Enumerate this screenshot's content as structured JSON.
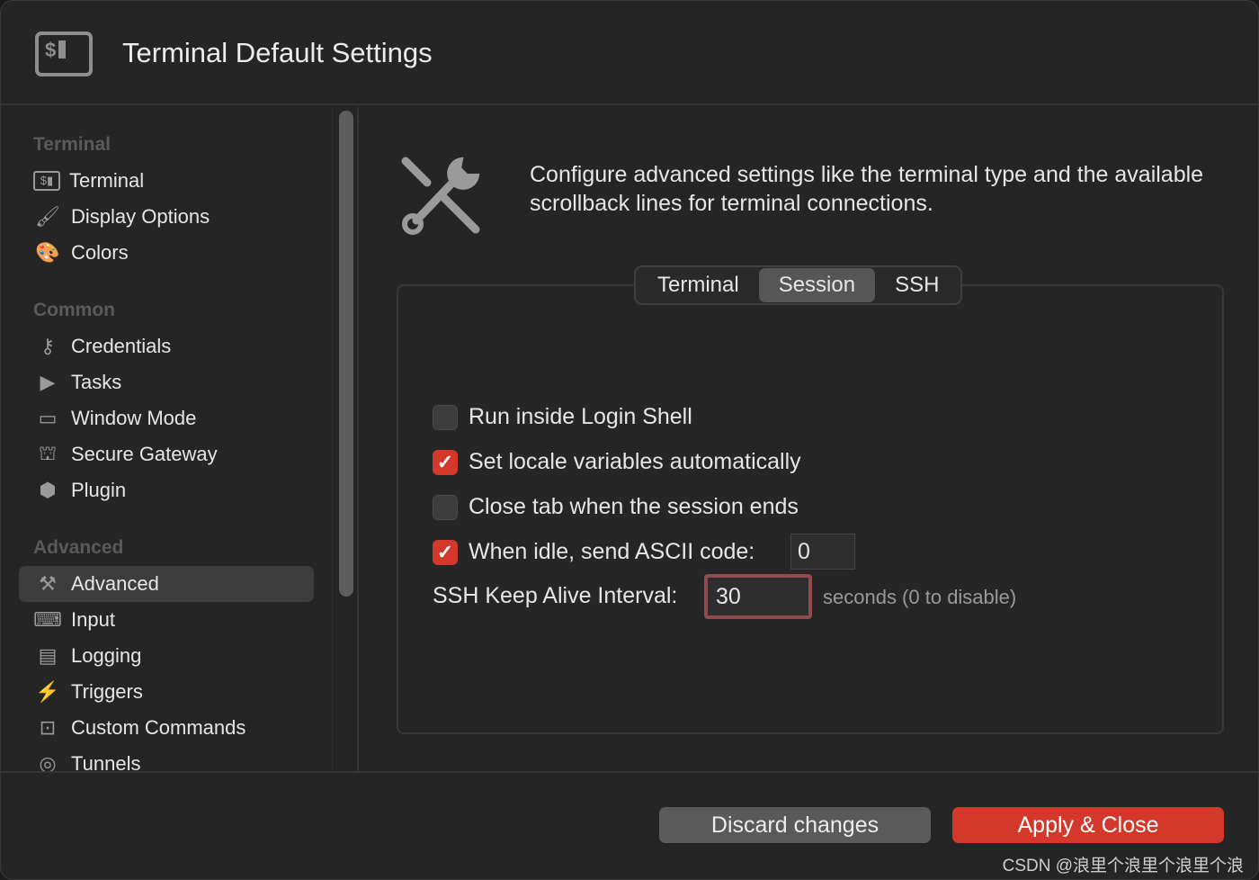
{
  "window": {
    "title": "Terminal Default Settings",
    "icon": "terminal-icon"
  },
  "sidebar": {
    "sections": [
      {
        "label": "Terminal",
        "items": [
          {
            "label": "Terminal",
            "icon": "terminal-icon"
          },
          {
            "label": "Display Options",
            "icon": "paintbrush-icon"
          },
          {
            "label": "Colors",
            "icon": "palette-icon"
          }
        ]
      },
      {
        "label": "Common",
        "items": [
          {
            "label": "Credentials",
            "icon": "key-icon"
          },
          {
            "label": "Tasks",
            "icon": "tasks-icon"
          },
          {
            "label": "Window Mode",
            "icon": "window-icon"
          },
          {
            "label": "Secure Gateway",
            "icon": "gateway-icon"
          },
          {
            "label": "Plugin",
            "icon": "cube-icon"
          }
        ]
      },
      {
        "label": "Advanced",
        "items": [
          {
            "label": "Advanced",
            "icon": "tools-icon",
            "selected": true
          },
          {
            "label": "Input",
            "icon": "keyboard-icon"
          },
          {
            "label": "Logging",
            "icon": "log-icon"
          },
          {
            "label": "Triggers",
            "icon": "trigger-icon"
          },
          {
            "label": "Custom Commands",
            "icon": "command-icon"
          },
          {
            "label": "Tunnels",
            "icon": "tunnel-icon"
          }
        ]
      }
    ]
  },
  "main": {
    "description": "Configure advanced settings like the terminal type and the available scrollback lines for terminal connections.",
    "tabs": [
      {
        "label": "Terminal"
      },
      {
        "label": "Session",
        "selected": true
      },
      {
        "label": "SSH"
      }
    ],
    "options": [
      {
        "label": "Run inside Login Shell",
        "checked": false
      },
      {
        "label": "Set locale variables automatically",
        "checked": true
      },
      {
        "label": "Close tab when the session ends",
        "checked": false
      },
      {
        "label": "When idle, send ASCII code:",
        "checked": true,
        "value": "0"
      }
    ],
    "keepalive": {
      "label": "SSH Keep Alive Interval:",
      "value": "30",
      "hint": "seconds (0 to disable)"
    }
  },
  "footer": {
    "discard": "Discard changes",
    "apply": "Apply & Close"
  },
  "watermark": "CSDN @浪里个浪里个浪里个浪",
  "colors": {
    "accent": "#d3382a",
    "bg": "#252525"
  }
}
